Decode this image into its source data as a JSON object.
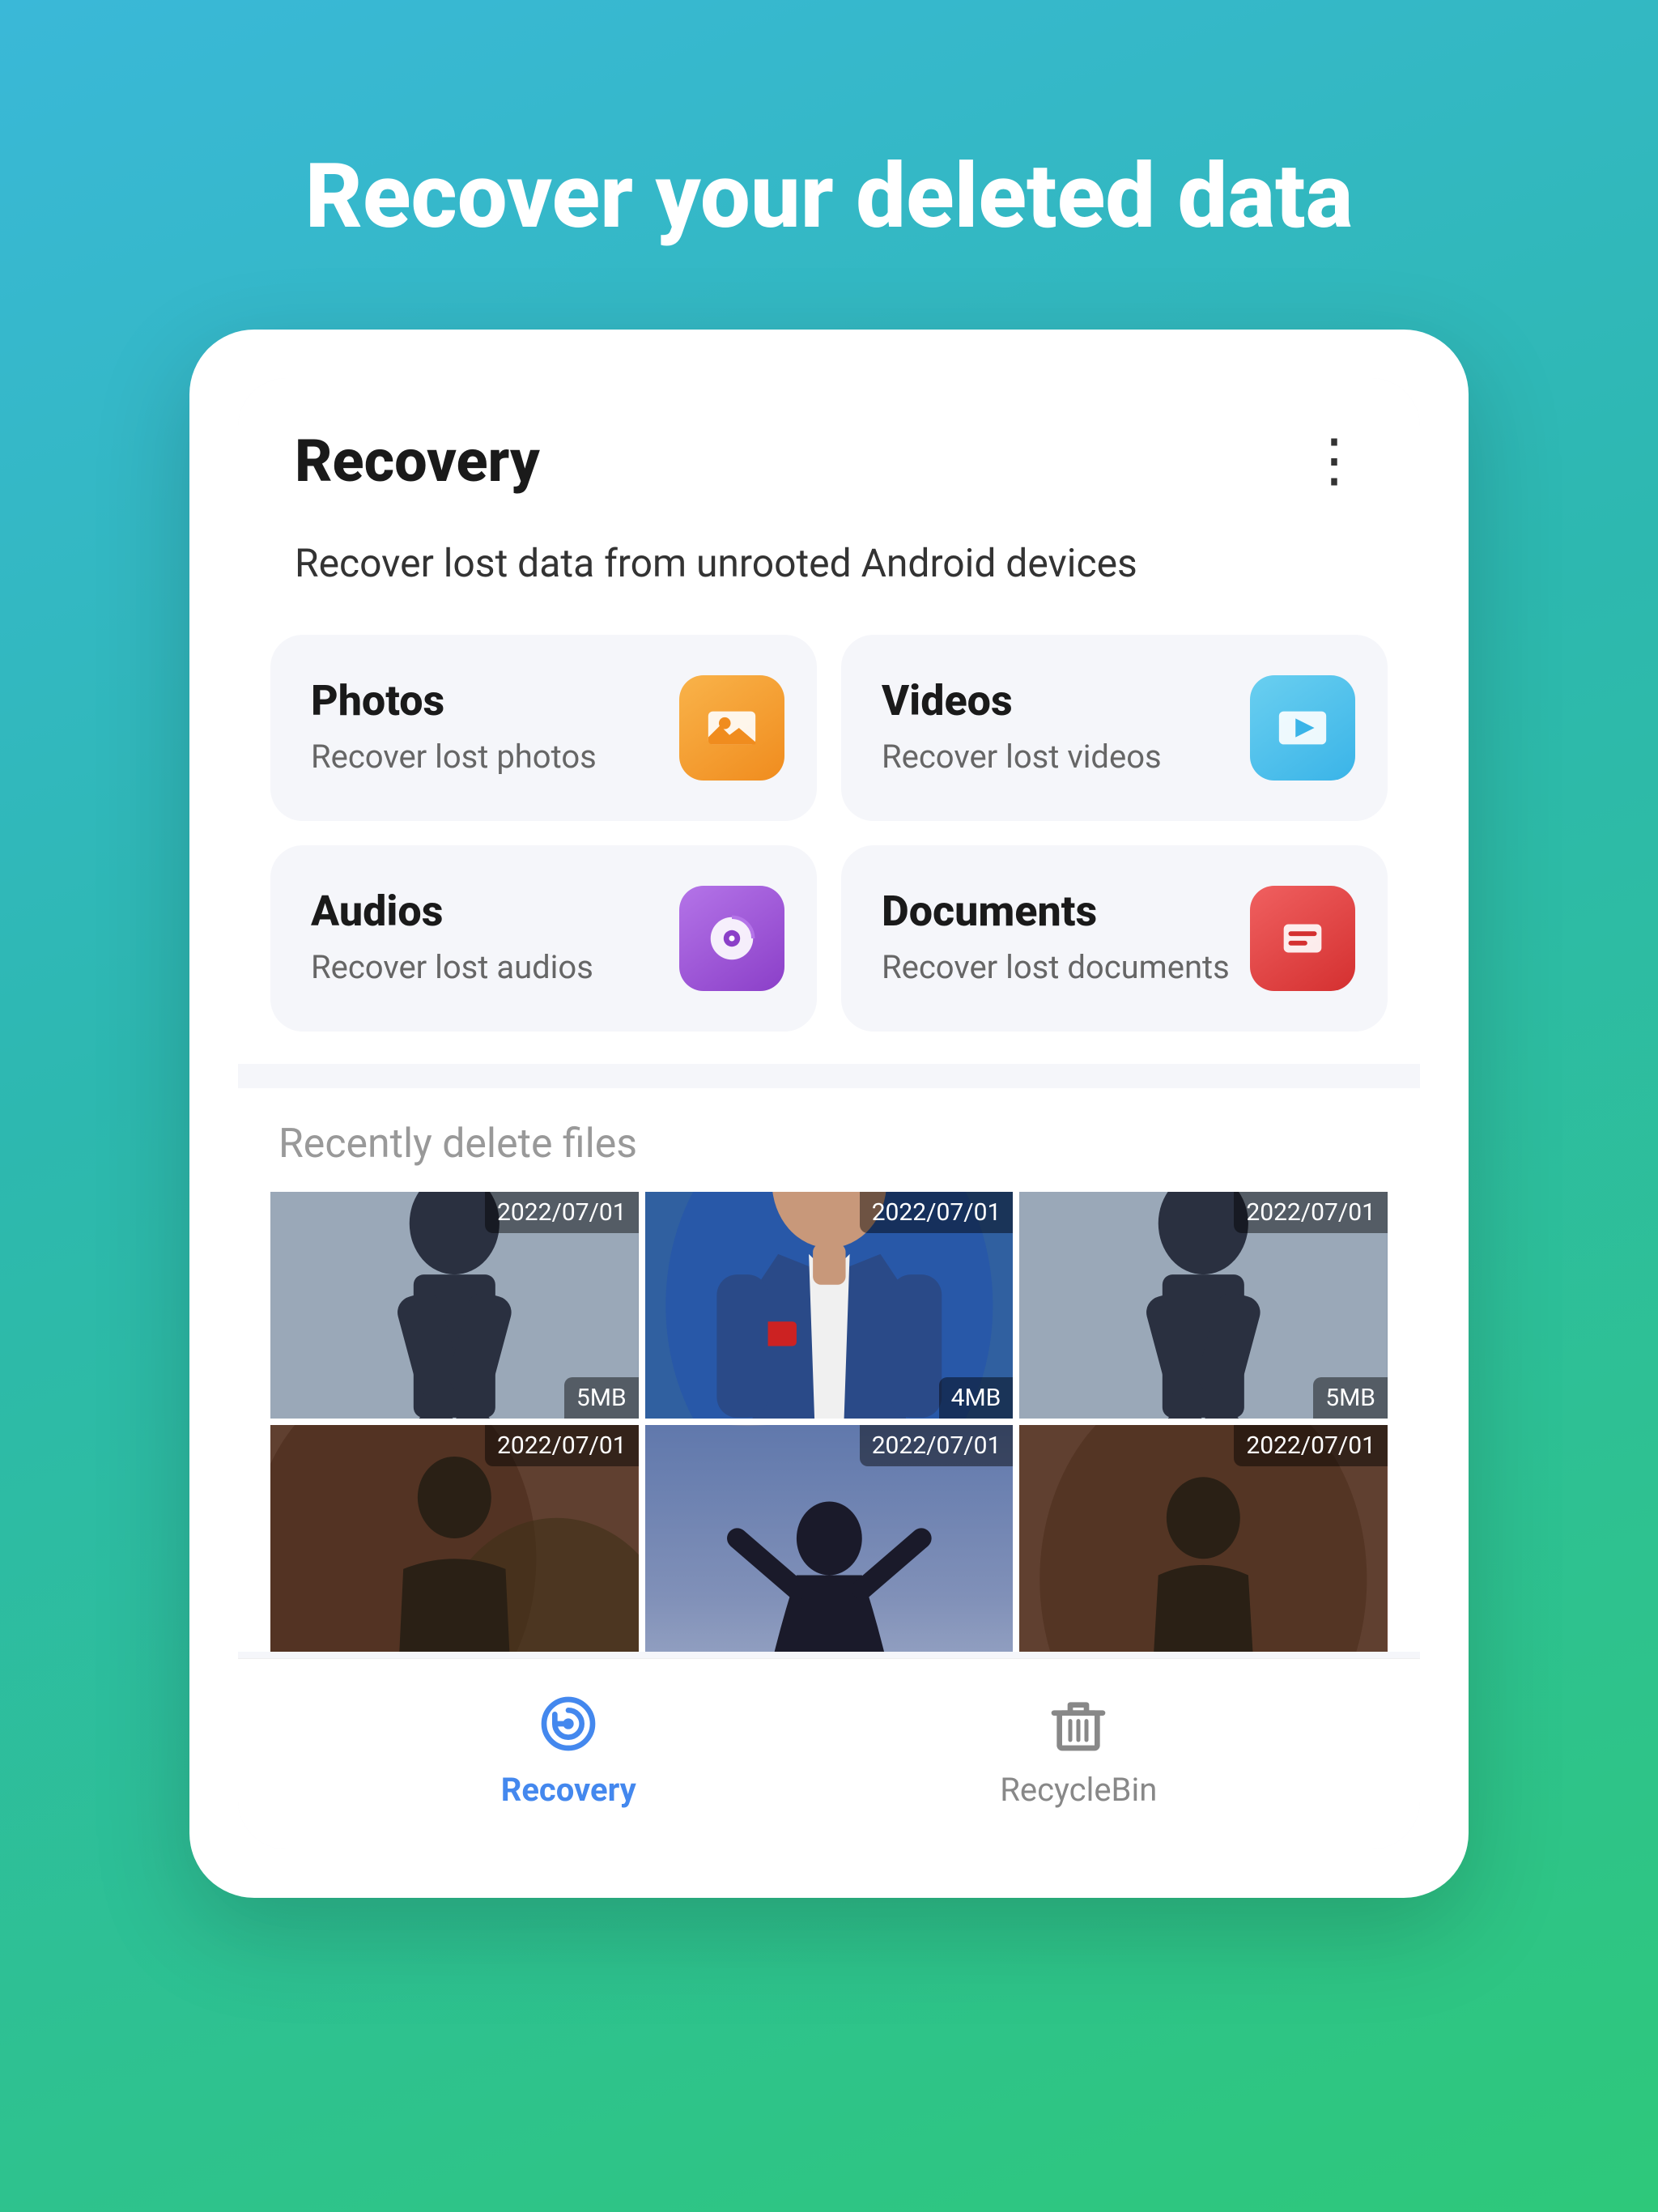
{
  "page": {
    "main_title": "Recover your deleted data",
    "background_gradient": "linear-gradient(160deg, #3ab8d8, #2ec87a)"
  },
  "app": {
    "header_title": "Recovery",
    "dots_menu": "⋮",
    "subtitle": "Recover lost data from unrooted Android devices",
    "recovery_items": [
      {
        "id": "photos",
        "title": "Photos",
        "desc": "Recover lost photos",
        "icon_type": "photos",
        "icon_color": "photos"
      },
      {
        "id": "videos",
        "title": "Videos",
        "desc": "Recover lost videos",
        "icon_type": "videos",
        "icon_color": "videos"
      },
      {
        "id": "audios",
        "title": "Audios",
        "desc": "Recover lost audios",
        "icon_type": "audios",
        "icon_color": "audios"
      },
      {
        "id": "documents",
        "title": "Documents",
        "desc": "Recover lost documents",
        "icon_type": "documents",
        "icon_color": "documents"
      }
    ],
    "recently_title": "Recently delete files",
    "photos": [
      {
        "date": "2022/07/01",
        "size": "5MB",
        "style": "photo-1"
      },
      {
        "date": "2022/07/01",
        "size": "4MB",
        "style": "photo-2"
      },
      {
        "date": "2022/07/01",
        "size": "5MB",
        "style": "photo-3"
      },
      {
        "date": "2022/07/01",
        "size": "",
        "style": "photo-4"
      },
      {
        "date": "2022/07/01",
        "size": "",
        "style": "photo-5"
      },
      {
        "date": "2022/07/01",
        "size": "",
        "style": "photo-6"
      }
    ],
    "nav": [
      {
        "id": "recovery",
        "label": "Recovery",
        "active": true
      },
      {
        "id": "recycle",
        "label": "RecycleBin",
        "active": false
      }
    ]
  }
}
